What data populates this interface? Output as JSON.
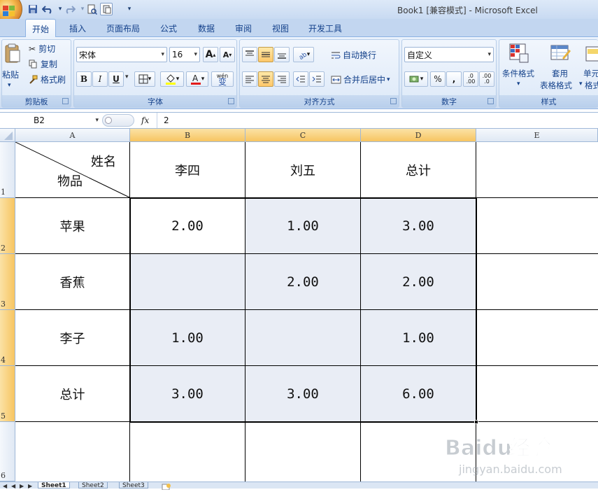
{
  "title": "Book1  [兼容模式] - Microsoft Excel",
  "tabs": [
    "开始",
    "插入",
    "页面布局",
    "公式",
    "数据",
    "审阅",
    "视图",
    "开发工具"
  ],
  "clipboard": {
    "paste": "粘贴",
    "cut": "剪切",
    "copy": "复制",
    "format_painter": "格式刷",
    "label": "剪贴板"
  },
  "font": {
    "name": "宋体",
    "size": "16",
    "bold": "B",
    "italic": "I",
    "underline": "U",
    "grow": "A",
    "shrink": "A",
    "phonetic": "wén",
    "label": "字体"
  },
  "alignment": {
    "wrap": "自动换行",
    "merge": "合并后居中",
    "label": "对齐方式"
  },
  "number": {
    "format": "自定义",
    "percent": "%",
    "comma": ",",
    "inc_decimal": ".0\n.00",
    "dec_decimal": ".00\n.0",
    "label": "数字"
  },
  "styles": {
    "conditional": "条件格式",
    "table_format_1": "套用",
    "table_format_2": "表格格式",
    "cell_style_1": "单元",
    "cell_style_2": "格式",
    "label": "样式"
  },
  "formula_bar": {
    "name_box": "B2",
    "fx": "fx",
    "value": "2"
  },
  "columns": [
    "A",
    "B",
    "C",
    "D",
    "E"
  ],
  "rows": [
    "1",
    "2",
    "3",
    "4",
    "5",
    "6"
  ],
  "header_cell": {
    "top_right": "姓名",
    "bottom_left": "物品"
  },
  "table": {
    "headers": [
      "李四",
      "刘五",
      "总计"
    ],
    "rows": [
      {
        "item": "苹果",
        "values": [
          "2.00",
          "1.00",
          "3.00"
        ]
      },
      {
        "item": "香蕉",
        "values": [
          "",
          "2.00",
          "2.00"
        ]
      },
      {
        "item": "李子",
        "values": [
          "1.00",
          "",
          "1.00"
        ]
      },
      {
        "item": "总计",
        "values": [
          "3.00",
          "3.00",
          "6.00"
        ]
      }
    ]
  },
  "sheets": [
    "Sheet1",
    "Sheet2",
    "Sheet3"
  ],
  "colors": {
    "selection_fill": "#e9edf5",
    "header_selected": "#f7c561",
    "ribbon": "#dce8f7"
  },
  "watermark": {
    "brand": "Baidu经验",
    "url": "jingyan.baidu.com"
  }
}
